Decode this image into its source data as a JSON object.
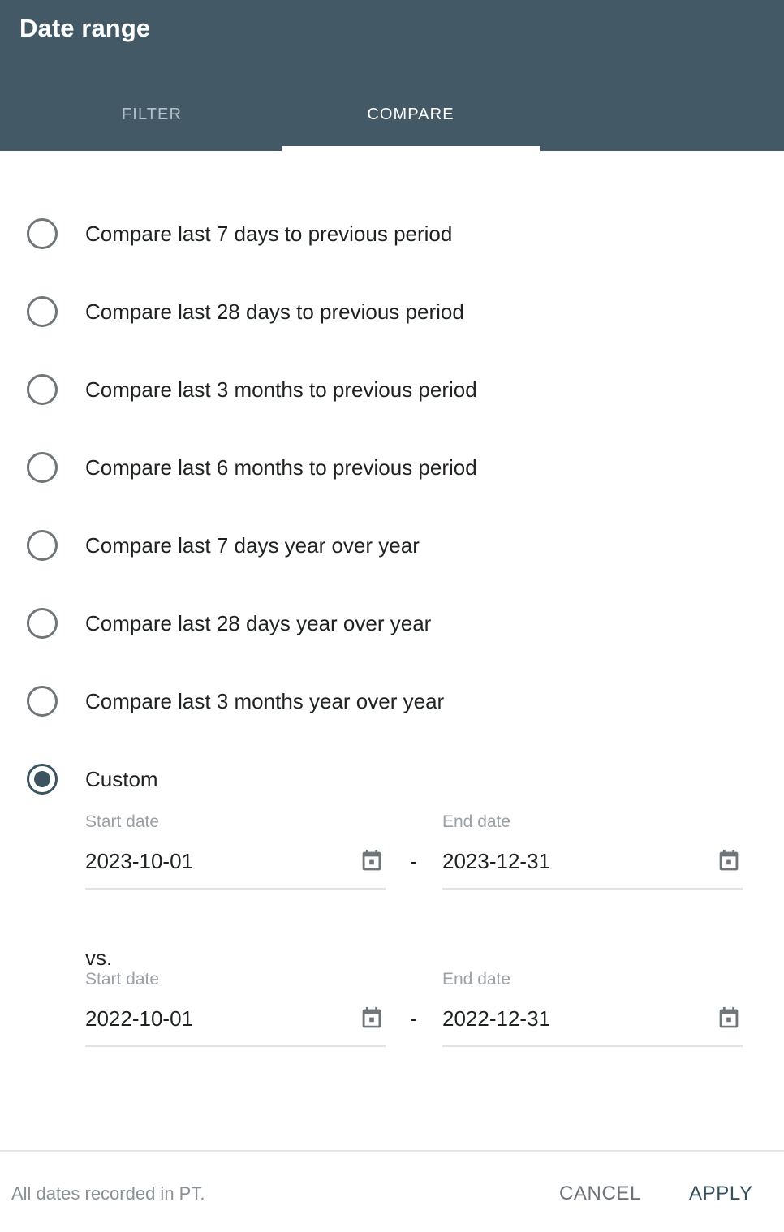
{
  "dialog": {
    "title": "Date range"
  },
  "tabs": [
    {
      "id": "filter",
      "label": "FILTER",
      "active": false
    },
    {
      "id": "compare",
      "label": "COMPARE",
      "active": true
    }
  ],
  "options": [
    {
      "id": "last-7-days-previous-period",
      "label": "Compare last 7 days to previous period",
      "selected": false
    },
    {
      "id": "last-28-days-previous-period",
      "label": "Compare last 28 days to previous period",
      "selected": false
    },
    {
      "id": "last-3-months-previous-period",
      "label": "Compare last 3 months to previous period",
      "selected": false
    },
    {
      "id": "last-6-months-previous-period",
      "label": "Compare last 6 months to previous period",
      "selected": false
    },
    {
      "id": "last-7-days-year-over-year",
      "label": "Compare last 7 days year over year",
      "selected": false
    },
    {
      "id": "last-28-days-year-over-year",
      "label": "Compare last 28 days year over year",
      "selected": false
    },
    {
      "id": "last-3-months-year-over-year",
      "label": "Compare last 3 months year over year",
      "selected": false
    },
    {
      "id": "custom",
      "label": "Custom",
      "selected": true
    }
  ],
  "custom": {
    "primary": {
      "start_caption": "Start date",
      "start_value": "2023-10-01",
      "end_caption": "End date",
      "end_value": "2023-12-31",
      "separator": "-"
    },
    "vs_label": "vs.",
    "comparison": {
      "start_caption": "Start date",
      "start_value": "2022-10-01",
      "end_caption": "End date",
      "end_value": "2022-12-31",
      "separator": "-"
    },
    "calendar_icon": "calendar-icon"
  },
  "footer": {
    "note": "All dates recorded in PT.",
    "cancel_label": "CANCEL",
    "apply_label": "APPLY"
  },
  "colors": {
    "header_bg": "#435a66",
    "accent": "#3c5460",
    "apply_text": "#37505d",
    "cancel_text": "#6d7378",
    "radio_border": "#6f7579",
    "muted_text": "#9aa0a6",
    "body_text": "#1f2223",
    "tab_inactive": "#b3c0c7",
    "underline": "#e2e3e4"
  }
}
